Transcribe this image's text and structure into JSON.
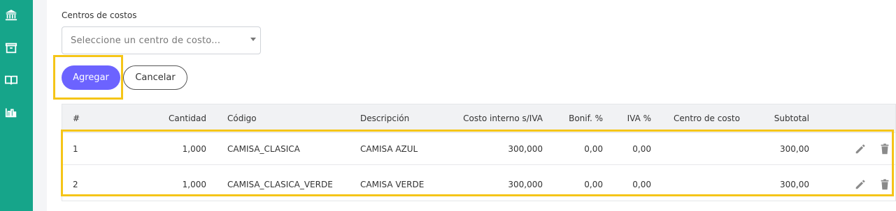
{
  "sidebar": {
    "icons": [
      "bank-icon",
      "box-icon",
      "book-icon",
      "bar-chart-icon"
    ]
  },
  "form": {
    "cost_center_label": "Centros de costos",
    "cost_center_placeholder": "Seleccione un centro de costo...",
    "add_label": "Agregar",
    "cancel_label": "Cancelar"
  },
  "table": {
    "headers": {
      "num": "#",
      "cantidad": "Cantidad",
      "codigo": "Código",
      "descripcion": "Descripción",
      "costo": "Costo interno s/IVA",
      "bonif": "Bonif. %",
      "iva": "IVA %",
      "centro": "Centro de costo",
      "subtotal": "Subtotal"
    },
    "rows": [
      {
        "num": "1",
        "cantidad": "1,000",
        "codigo": "CAMISA_CLASICA",
        "descripcion": "CAMISA AZUL",
        "costo": "300,000",
        "bonif": "0,00",
        "iva": "0,00",
        "centro": "",
        "subtotal": "300,00"
      },
      {
        "num": "2",
        "cantidad": "1,000",
        "codigo": "CAMISA_CLASICA_VERDE",
        "descripcion": "CAMISA VERDE",
        "costo": "300,000",
        "bonif": "0,00",
        "iva": "0,00",
        "centro": "",
        "subtotal": "300,00"
      }
    ]
  },
  "colors": {
    "sidebar": "#16a58a",
    "primary": "#6c63ff",
    "highlight": "#f5c518"
  }
}
